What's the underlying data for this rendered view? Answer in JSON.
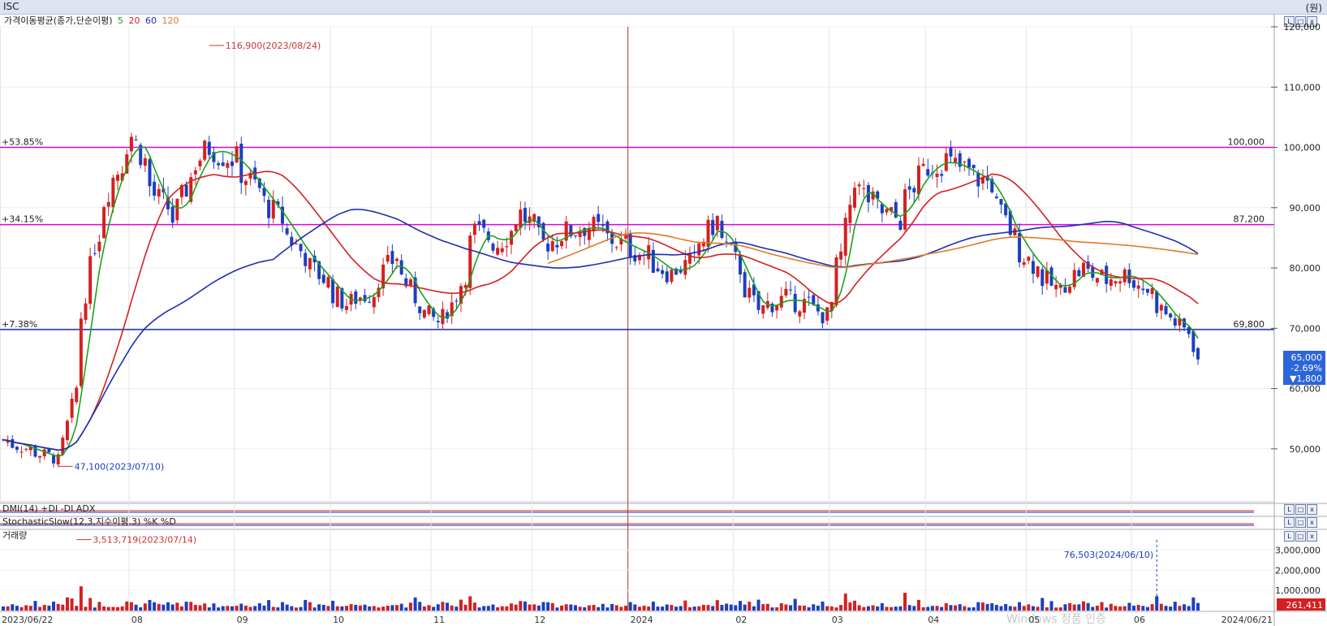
{
  "window": {
    "title": "ISC",
    "unit": "(원)"
  },
  "legend": {
    "prefix": "가격이동평균(종가,단순이평)",
    "periods": [
      {
        "label": "5",
        "color": "#1aa31a"
      },
      {
        "label": "20",
        "color": "#d42020"
      },
      {
        "label": "60",
        "color": "#1c2fb0"
      },
      {
        "label": "120",
        "color": "#e07a2a"
      }
    ]
  },
  "indicators": {
    "dmi": "DMI(14)  +DI  -DI  ADX",
    "stoch": "StochasticSlow(12,3,지수이평,3)  %K  %D",
    "volume": "거래량"
  },
  "panel_buttons": [
    "L",
    "□",
    "x"
  ],
  "annotations": {
    "high": "116,900(2023/08/24)",
    "low": "47,100(2023/07/10)",
    "vol_high": "3,513,719(2023/07/14)",
    "vol_recent": "76,503(2024/06/10)"
  },
  "hlines": [
    {
      "pct": "+53.85%",
      "value_label": "100,000",
      "value": 100000,
      "color": "#e000e0"
    },
    {
      "pct": "+34.15%",
      "value_label": "87,200",
      "value": 87200,
      "color": "#e000e0"
    },
    {
      "pct": "+7.38%",
      "value_label": "69,800",
      "value": 69800,
      "color": "#1c2fb0"
    }
  ],
  "current": {
    "price": "65,000",
    "change_pct": "-2.69%",
    "change": "▼1,800"
  },
  "volume_current": "261,411",
  "watermark": "Windows 정품 인증",
  "chart_data": {
    "type": "candlestick",
    "y_axis": {
      "min": 45000,
      "max": 120000,
      "ticks": [
        "120,000",
        "110,000",
        "100,000",
        "90,000",
        "80,000",
        "70,000",
        "60,000",
        "50,000"
      ],
      "tick_values": [
        120000,
        110000,
        100000,
        90000,
        80000,
        70000,
        60000,
        50000
      ]
    },
    "volume_axis": {
      "ticks": [
        "3,000,000",
        "2,000,000",
        "1,000,000"
      ],
      "tick_values": [
        3000000,
        2000000,
        1000000
      ],
      "max": 3700000
    },
    "x_axis": {
      "labels": [
        "2023/06/22",
        "08",
        "09",
        "10",
        "11",
        "12",
        "2024",
        "02",
        "03",
        "04",
        "05",
        "06",
        "2024/06/21"
      ]
    },
    "month_boundaries": [
      "2023/08",
      "2023/09",
      "2023/10",
      "2023/11",
      "2023/12",
      "2024/01",
      "2024/02",
      "2024/03",
      "2024/04",
      "2024/05",
      "2024/06"
    ],
    "close_anchors": [
      [
        "2023/06/22",
        51500
      ],
      [
        "2023/07/10",
        48000
      ],
      [
        "2023/07/14",
        60000
      ],
      [
        "2023/07/20",
        84000
      ],
      [
        "2023/07/26",
        95000
      ],
      [
        "2023/08/01",
        102000
      ],
      [
        "2023/08/08",
        92000
      ],
      [
        "2023/08/14",
        88000
      ],
      [
        "2023/08/18",
        95000
      ],
      [
        "2023/08/24",
        100000
      ],
      [
        "2023/09/01",
        98000
      ],
      [
        "2023/09/08",
        93000
      ],
      [
        "2023/09/15",
        88000
      ],
      [
        "2023/09/22",
        82000
      ],
      [
        "2023/10/05",
        74000
      ],
      [
        "2023/10/13",
        76000
      ],
      [
        "2023/10/20",
        82000
      ],
      [
        "2023/10/27",
        74000
      ],
      [
        "2023/11/02",
        71000
      ],
      [
        "2023/11/07",
        74000
      ],
      [
        "2023/11/14",
        86000
      ],
      [
        "2023/11/21",
        84000
      ],
      [
        "2023/11/28",
        89000
      ],
      [
        "2023/12/05",
        84000
      ],
      [
        "2023/12/12",
        86000
      ],
      [
        "2023/12/19",
        87000
      ],
      [
        "2023/12/28",
        84000
      ],
      [
        "2024/01/05",
        82000
      ],
      [
        "2024/01/12",
        79000
      ],
      [
        "2024/01/19",
        81000
      ],
      [
        "2024/01/26",
        88000
      ],
      [
        "2024/02/02",
        80000
      ],
      [
        "2024/02/08",
        73000
      ],
      [
        "2024/02/16",
        75000
      ],
      [
        "2024/02/23",
        74000
      ],
      [
        "2024/02/29",
        72000
      ],
      [
        "2024/03/05",
        82000
      ],
      [
        "2024/03/08",
        95000
      ],
      [
        "2024/03/15",
        90000
      ],
      [
        "2024/03/22",
        88000
      ],
      [
        "2024/03/29",
        96000
      ],
      [
        "2024/04/05",
        98000
      ],
      [
        "2024/04/12",
        96000
      ],
      [
        "2024/04/19",
        94000
      ],
      [
        "2024/04/26",
        85000
      ],
      [
        "2024/05/03",
        80000
      ],
      [
        "2024/05/10",
        76000
      ],
      [
        "2024/05/17",
        80000
      ],
      [
        "2024/05/24",
        78000
      ],
      [
        "2024/05/31",
        79000
      ],
      [
        "2024/06/07",
        76000
      ],
      [
        "2024/06/14",
        71000
      ],
      [
        "2024/06/19",
        69500
      ],
      [
        "2024/06/21",
        65000
      ]
    ],
    "moving_averages": [
      {
        "period": 5,
        "color": "#1aa31a"
      },
      {
        "period": 20,
        "color": "#d42020"
      },
      {
        "period": 60,
        "color": "#1c2fb0"
      },
      {
        "period": 120,
        "color": "#e07a2a"
      }
    ]
  }
}
